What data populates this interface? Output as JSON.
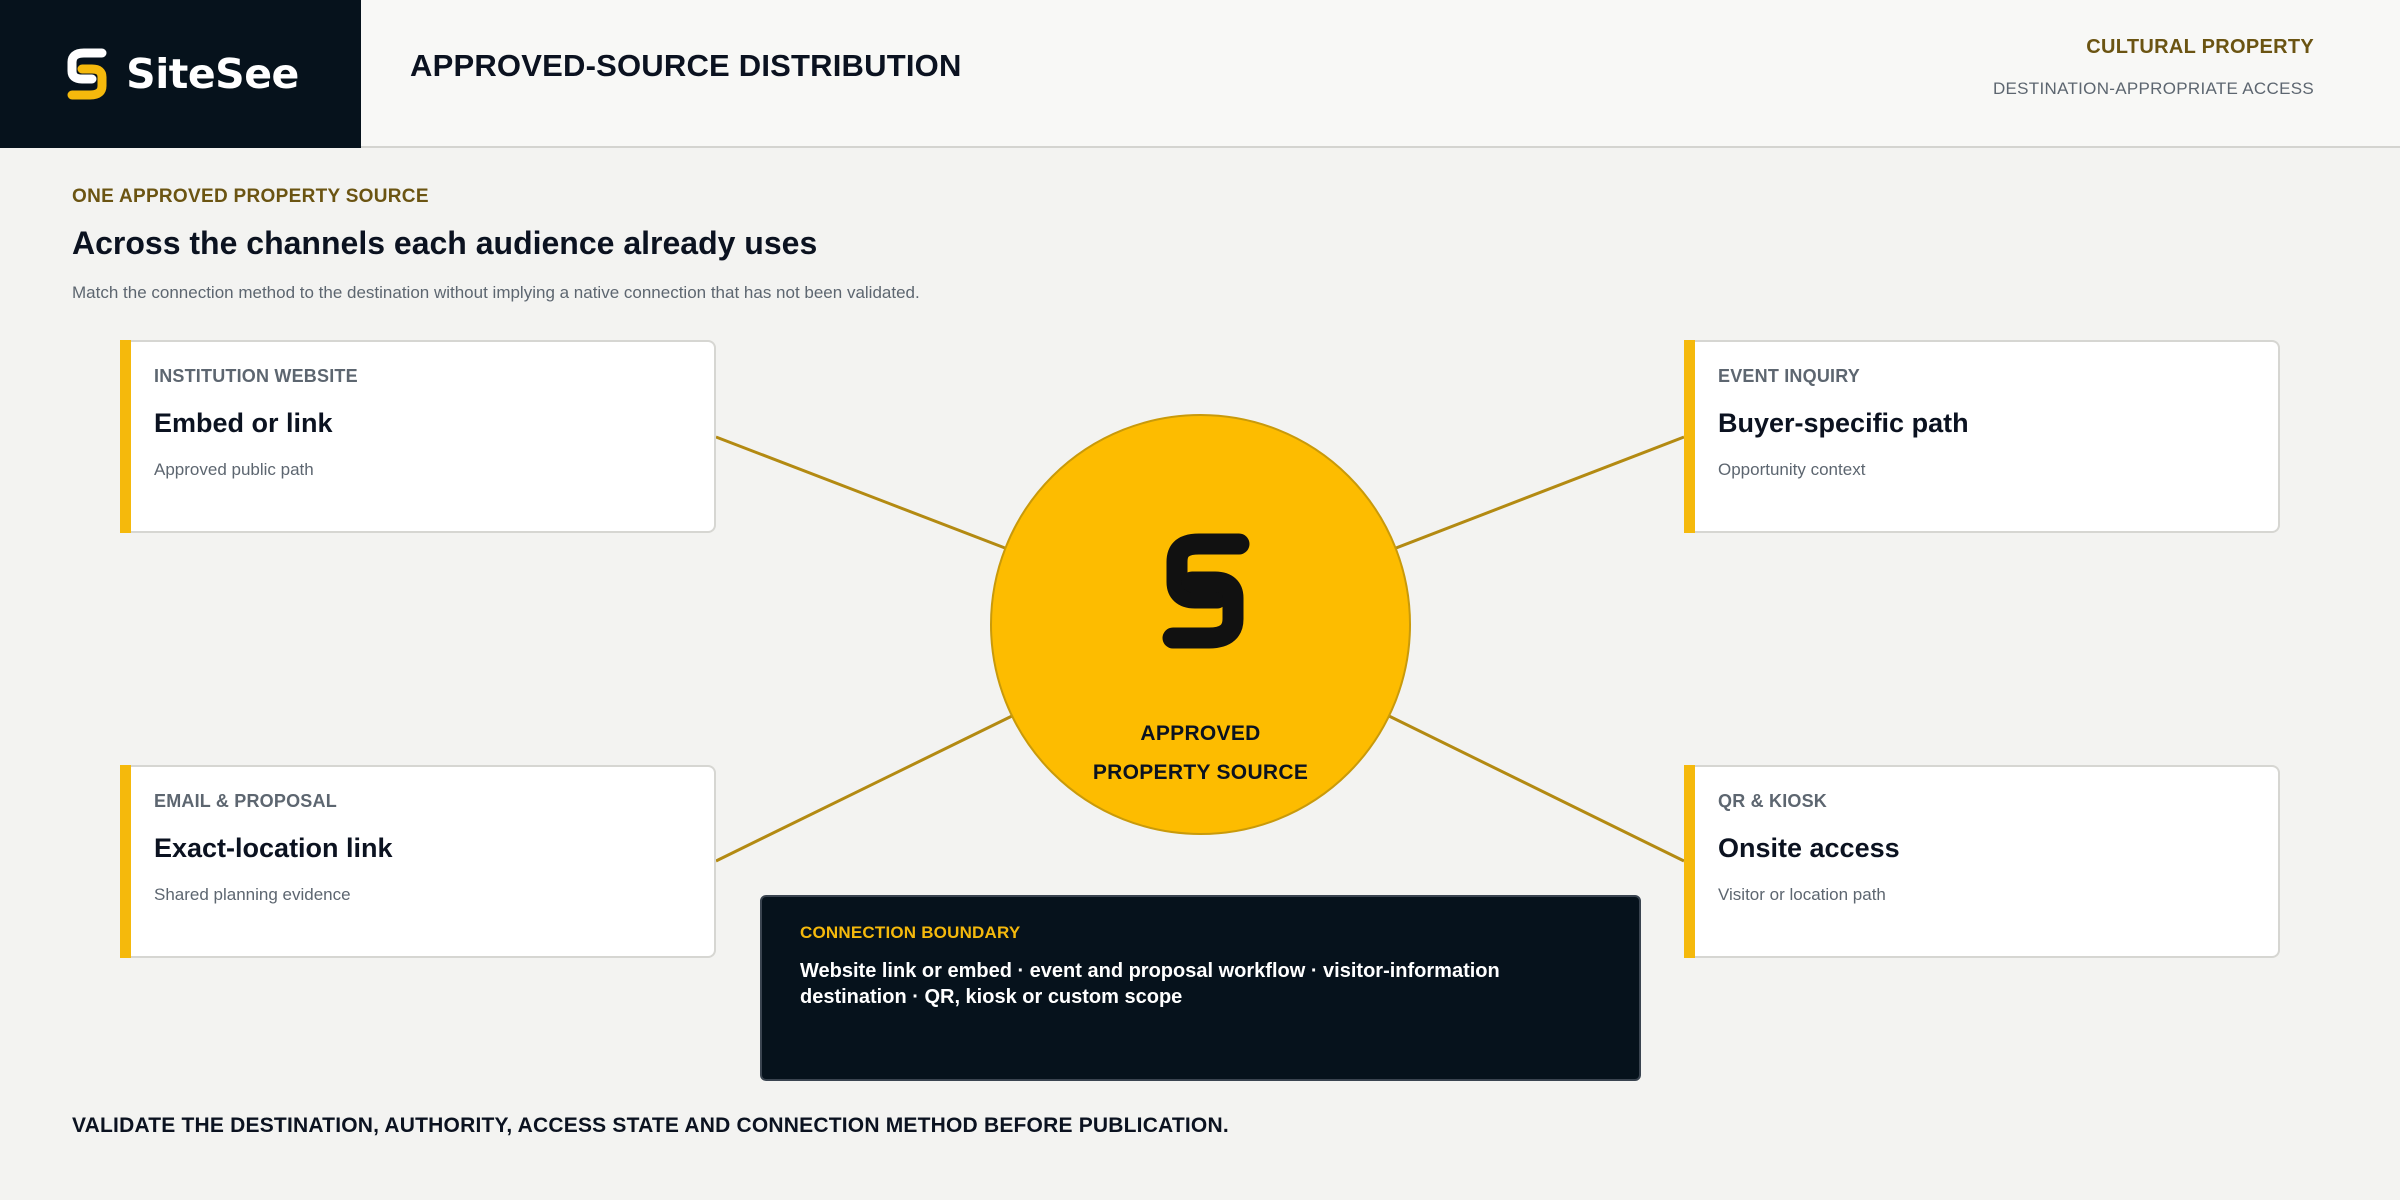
{
  "brand": {
    "name": "SiteSee",
    "logo_icon": "sitesee-logo-icon",
    "accent_color": "#f5b90c",
    "dark_color": "#06121c"
  },
  "header": {
    "title": "APPROVED-SOURCE DISTRIBUTION",
    "kicker": "CULTURAL PROPERTY",
    "subtitle": "DESTINATION-APPROPRIATE ACCESS"
  },
  "intro": {
    "eyebrow": "ONE APPROVED PROPERTY SOURCE",
    "headline": "Across the channels each audience already uses",
    "lede": "Match the connection method to the destination without implying a native connection that has not been validated."
  },
  "hub": {
    "label_line1": "APPROVED",
    "label_line2": "PROPERTY SOURCE",
    "icon": "sitesee-logo-icon",
    "fill_color": "#fdbc00"
  },
  "channels": [
    {
      "kicker": "INSTITUTION WEBSITE",
      "title": "Embed or link",
      "note": "Approved public path"
    },
    {
      "kicker": "EVENT INQUIRY",
      "title": "Buyer-specific path",
      "note": "Opportunity context"
    },
    {
      "kicker": "EMAIL & PROPOSAL",
      "title": "Exact-location link",
      "note": "Shared planning evidence"
    },
    {
      "kicker": "QR & KIOSK",
      "title": "Onsite access",
      "note": "Visitor or location path"
    }
  ],
  "boundary": {
    "kicker": "CONNECTION BOUNDARY",
    "body": "Website link or embed · event and proposal workflow · visitor-information destination · QR, kiosk or custom scope"
  },
  "footer": {
    "note": "VALIDATE THE DESTINATION, AUTHORITY, ACCESS STATE AND CONNECTION METHOD BEFORE PUBLICATION."
  }
}
